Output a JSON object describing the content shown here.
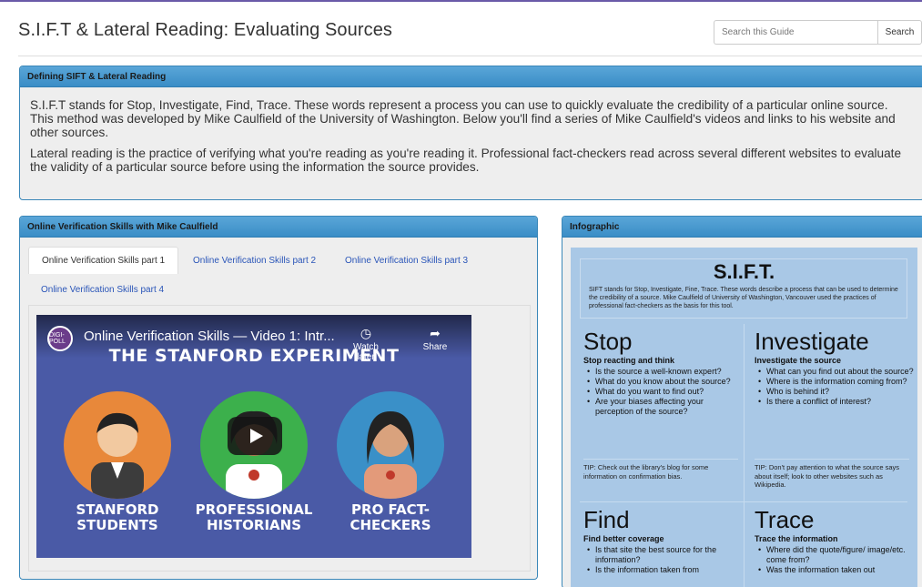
{
  "page": {
    "title": "S.I.F.T & Lateral Reading: Evaluating Sources",
    "search_placeholder": "Search this Guide",
    "search_button": "Search"
  },
  "colors": {
    "panel_header": "#4a9bd2",
    "accent_purple": "#6a5aa8",
    "video_bg": "#4a5aa6",
    "infographic_bg": "#a9c8e6"
  },
  "panels": {
    "definition": {
      "title": "Defining SIFT & Lateral Reading",
      "paragraphs": [
        "S.I.F.T stands for Stop, Investigate, Find, Trace. These words represent a process you can use to quickly evaluate the credibility of a particular online source. This method was developed by Mike Caulfield of the University of Washington. Below you'll find a series of Mike Caulfield's videos and links to his website and other sources.",
        "Lateral reading is the practice of verifying what you're reading as you're reading it. Professional fact-checkers read across several different websites to evaluate the validity of a particular source before using the information the source provides."
      ]
    },
    "videos": {
      "title": "Online Verification Skills with Mike Caulfield",
      "tabs": [
        {
          "label": "Online Verification Skills part 1",
          "active": true
        },
        {
          "label": "Online Verification Skills part 2",
          "active": false
        },
        {
          "label": "Online Verification Skills part 3",
          "active": false
        },
        {
          "label": "Online Verification Skills part 4",
          "active": false
        }
      ],
      "video": {
        "channel_logo": "DIGI-POLL",
        "title": "Online Verification Skills — Video 1: Intr...",
        "banner": "THE STANFORD EXPERIMENT",
        "watch_later": "Watch later",
        "share": "Share",
        "labels": [
          "STANFORD STUDENTS",
          "PROFESSIONAL HISTORIANS",
          "PRO FACT-CHECKERS"
        ]
      }
    },
    "infographic": {
      "title": "Infographic",
      "heading": "S.I.F.T.",
      "intro": "SIFT stands for Stop, Investigate, Fine, Trace. These words describe a process that can be used to determine the credibility of a source. Mike Caulfield of University of Washington, Vancouver used the practices of professional fact-checkers as the basis for this tool.",
      "sections": [
        {
          "title": "Stop",
          "subtitle": "Stop reacting and think",
          "items": [
            "Is the source a well-known expert?",
            "What do you know about the source?",
            "What do you want to find out?",
            "Are your biases affecting your perception of the source?"
          ],
          "tip": "TIP: Check out the library's blog for some information on confirmation bias."
        },
        {
          "title": "Investigate",
          "subtitle": "Investigate the source",
          "items": [
            "What can you find out about the source?",
            "Where is the information coming from?",
            "Who is behind it?",
            "Is there a conflict of interest?"
          ],
          "tip": "TIP: Don't pay attention to what the source says about itself; look to other websites such as Wikipedia."
        },
        {
          "title": "Find",
          "subtitle": "Find better coverage",
          "items": [
            "Is that site the best source for the information?",
            "Is the information taken from"
          ]
        },
        {
          "title": "Trace",
          "subtitle": "Trace the information",
          "items": [
            "Where did the quote/figure/ image/etc. come from?",
            "Was the information taken out"
          ]
        }
      ]
    }
  }
}
